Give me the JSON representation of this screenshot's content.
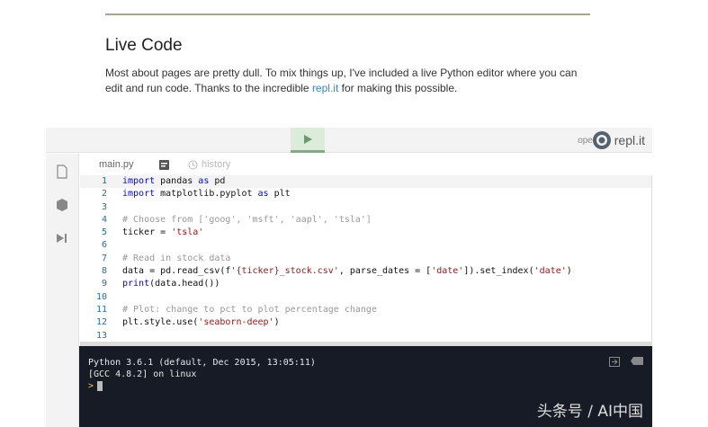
{
  "section": {
    "title": "Live Code",
    "para_1": "Most about pages are pretty dull. To mix things up, I've included a live Python editor where you can edit and run code. Thanks to the incredible ",
    "link": "repl.it",
    "para_2": " for making this possible."
  },
  "editor": {
    "open_in": "open in",
    "brand": "repl.it",
    "tabs": {
      "file": "main.py",
      "history": "history"
    },
    "code": [
      [
        [
          "kw",
          "import"
        ],
        [
          "plain",
          " pandas "
        ],
        [
          "kw",
          "as"
        ],
        [
          "plain",
          " pd"
        ]
      ],
      [
        [
          "kw",
          "import"
        ],
        [
          "plain",
          " matplotlib.pyplot "
        ],
        [
          "kw",
          "as"
        ],
        [
          "plain",
          " plt"
        ]
      ],
      [],
      [
        [
          "com",
          "# Choose from ['goog', 'msft', 'aapl', 'tsla']"
        ]
      ],
      [
        [
          "plain",
          "ticker = "
        ],
        [
          "str",
          "'tsla'"
        ]
      ],
      [],
      [
        [
          "com",
          "# Read in stock data"
        ]
      ],
      [
        [
          "plain",
          "data = pd.read_csv(f"
        ],
        [
          "str",
          "'{ticker}_stock.csv'"
        ],
        [
          "plain",
          ", parse_dates = ["
        ],
        [
          "str",
          "'date'"
        ],
        [
          "plain",
          "]).set_index("
        ],
        [
          "str",
          "'date'"
        ],
        [
          "plain",
          ")"
        ]
      ],
      [
        [
          "fn",
          "print"
        ],
        [
          "plain",
          "(data.head())"
        ]
      ],
      [],
      [
        [
          "com",
          "# Plot: change to pct to plot percentage change"
        ]
      ],
      [
        [
          "plain",
          "plt.style.use("
        ],
        [
          "str",
          "'seaborn-deep'"
        ],
        [
          "plain",
          ")"
        ]
      ],
      []
    ]
  },
  "console": {
    "line1": "Python 3.6.1 (default, Dec 2015, 13:05:11)",
    "line2": "[GCC 4.8.2] on linux",
    "prompt": ">"
  },
  "watermark": "头条号 / AI中国"
}
